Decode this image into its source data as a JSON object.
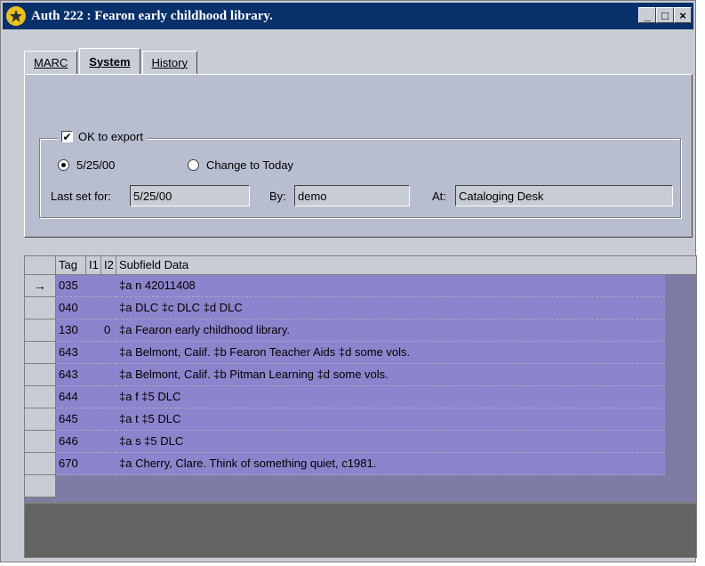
{
  "window": {
    "title": "Auth 222 : Fearon early childhood library.",
    "controls": {
      "minimize": "_",
      "maximize": "□",
      "close": "×"
    }
  },
  "tabs": [
    {
      "label": "MARC",
      "active": false
    },
    {
      "label": "System",
      "active": true
    },
    {
      "label": "History",
      "active": false
    }
  ],
  "system": {
    "ok_to_export_label": "OK to export",
    "ok_to_export_checked": true,
    "radio_date_label": "5/25/00",
    "radio_date_selected": true,
    "radio_today_label": "Change to Today",
    "radio_today_selected": false,
    "last_set_for_label": "Last set for:",
    "last_set_for_value": "5/25/00",
    "by_label": "By:",
    "by_value": "demo",
    "at_label": "At:",
    "at_value": "Cataloging Desk"
  },
  "grid": {
    "columns": [
      "Tag",
      "I1",
      "I2",
      "Subfield Data"
    ],
    "rows": [
      {
        "tag": "035",
        "i1": "",
        "i2": "",
        "data": "‡a n  42011408",
        "current": true
      },
      {
        "tag": "040",
        "i1": "",
        "i2": "",
        "data": "‡a DLC ‡c DLC ‡d DLC",
        "current": false
      },
      {
        "tag": "130",
        "i1": "",
        "i2": "0",
        "data": "‡a Fearon early childhood library.",
        "current": false
      },
      {
        "tag": "643",
        "i1": "",
        "i2": "",
        "data": "‡a Belmont, Calif. ‡b Fearon Teacher Aids ‡d some vols.",
        "current": false
      },
      {
        "tag": "643",
        "i1": "",
        "i2": "",
        "data": "‡a Belmont, Calif. ‡b Pitman Learning ‡d some vols.",
        "current": false
      },
      {
        "tag": "644",
        "i1": "",
        "i2": "",
        "data": "‡a f ‡5 DLC",
        "current": false
      },
      {
        "tag": "645",
        "i1": "",
        "i2": "",
        "data": "‡a t ‡5 DLC",
        "current": false
      },
      {
        "tag": "646",
        "i1": "",
        "i2": "",
        "data": "‡a s ‡5 DLC",
        "current": false
      },
      {
        "tag": "670",
        "i1": "",
        "i2": "",
        "data": "‡a Cherry, Clare. Think of something quiet, c1981.",
        "current": false
      }
    ],
    "current_row_marker": "→"
  },
  "colors": {
    "titlebar": "#08306b",
    "grid_row": "#8c84cc",
    "panel": "#b8bed0",
    "chrome": "#c8ccd4"
  }
}
